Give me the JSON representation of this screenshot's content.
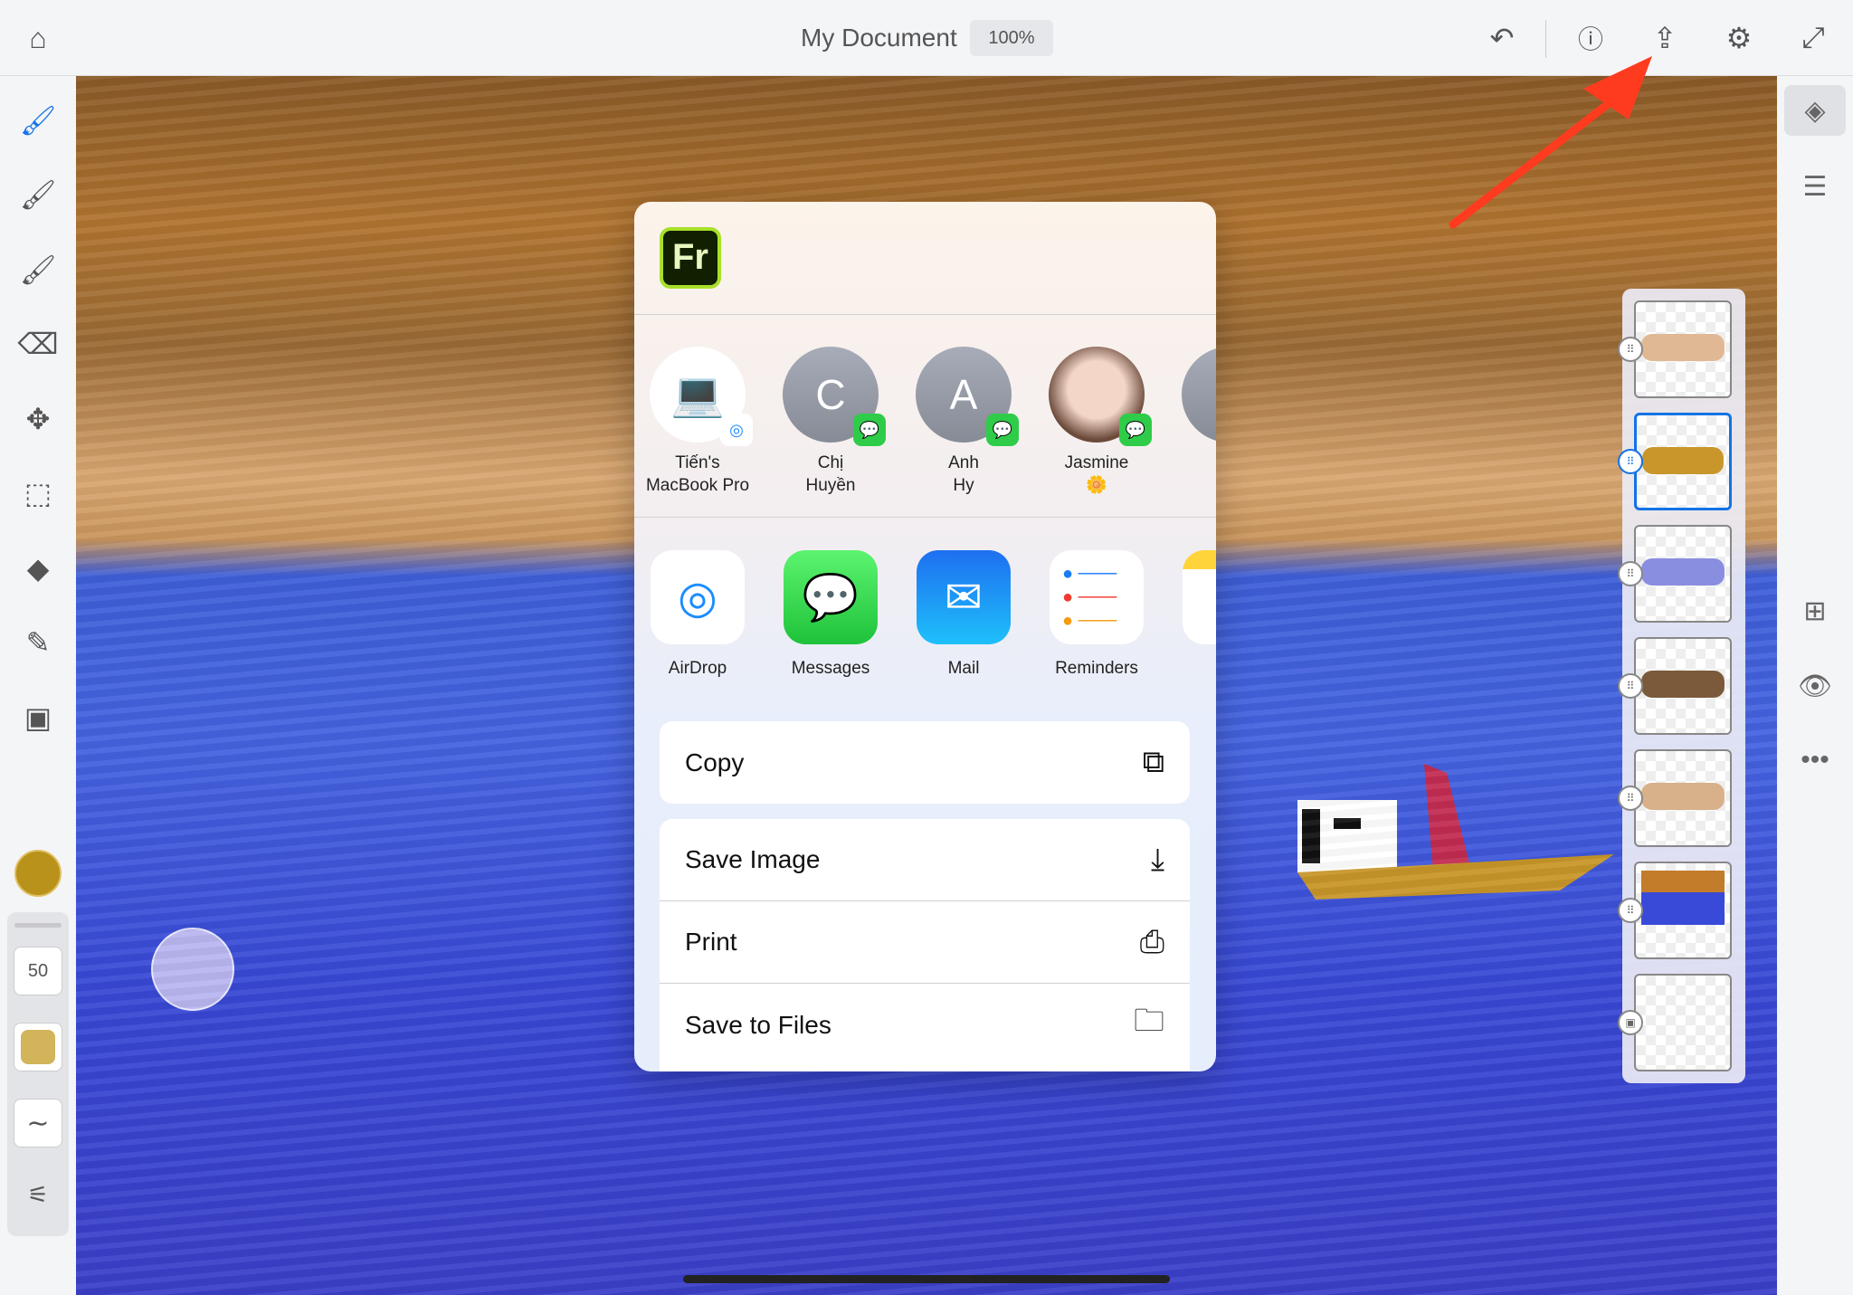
{
  "topbar": {
    "title": "My Document",
    "zoom": "100%",
    "icons": [
      "home-icon",
      "undo-icon",
      "help-icon",
      "share-icon",
      "settings-icon",
      "fullscreen-icon"
    ]
  },
  "left_toolbar": {
    "tools": [
      "pixel-brush",
      "live-brush",
      "vector-brush",
      "eraser",
      "transform",
      "selection",
      "fill",
      "eyedropper",
      "place-image"
    ],
    "color": "#b8921a",
    "brush_size": "50",
    "brush_color": "#d2b45a"
  },
  "right_toolbar": {
    "icons": [
      "layers-icon",
      "layer-properties-icon",
      "add-layer-icon",
      "visibility-icon",
      "more-icon"
    ]
  },
  "layers": {
    "count": 7,
    "selected_index": 1
  },
  "share_sheet": {
    "app": "Fr",
    "contacts": [
      {
        "name_line1": "Tiến's",
        "name_line2": "MacBook Pro",
        "type": "airdrop-device"
      },
      {
        "initial": "C",
        "name_line1": "Chị",
        "name_line2": "Huyền",
        "type": "messages"
      },
      {
        "initial": "A",
        "name_line1": "Anh",
        "name_line2": "Hy",
        "type": "messages"
      },
      {
        "name_line1": "Jasmine",
        "name_line2": "🌼",
        "type": "messages"
      }
    ],
    "apps": [
      {
        "label": "AirDrop"
      },
      {
        "label": "Messages"
      },
      {
        "label": "Mail"
      },
      {
        "label": "Reminders"
      }
    ],
    "actions_primary": [
      {
        "label": "Copy",
        "icon": "copy-icon"
      }
    ],
    "actions": [
      {
        "label": "Save Image",
        "icon": "save-image-icon"
      },
      {
        "label": "Print",
        "icon": "print-icon"
      },
      {
        "label": "Save to Files",
        "icon": "folder-icon"
      }
    ]
  },
  "annotation": {
    "arrow_color": "#ff3b1f"
  }
}
